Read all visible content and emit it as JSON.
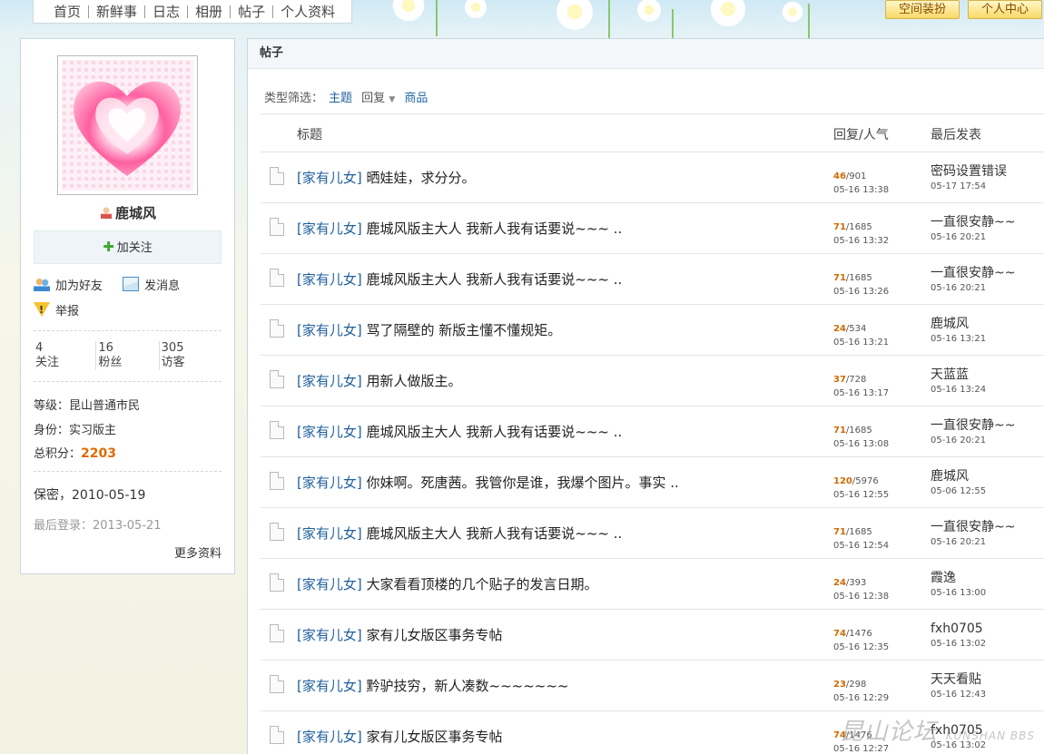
{
  "nav": {
    "items": [
      "首页",
      "新鲜事",
      "日志",
      "相册",
      "帖子",
      "个人资料"
    ],
    "decorate_button": "空间装扮",
    "user_center_button": "个人中心"
  },
  "profile": {
    "username": "鹿城风",
    "follow_label": "加关注",
    "add_friend_label": "加为好友",
    "message_label": "发消息",
    "report_label": "举报",
    "stats": [
      {
        "value": "4",
        "label": "关注"
      },
      {
        "value": "16",
        "label": "粉丝"
      },
      {
        "value": "305",
        "label": "访客"
      }
    ],
    "level_label": "等级：",
    "level_value": "昆山普通市民",
    "identity_label": "身份：",
    "identity_value": "实习版主",
    "score_label": "总积分：",
    "score_value": "2203",
    "secret_label": "保密，",
    "secret_date": "2010-05-19",
    "last_login_label": "最后登录：",
    "last_login_date": "2013-05-21",
    "more_label": "更多资料"
  },
  "main": {
    "header_title": "帖子",
    "filter_label": "类型筛选：",
    "filter_topic": "主题",
    "filter_reply": "回复",
    "filter_goods": "商品",
    "col_title": "标题",
    "col_stats": "回复/人气",
    "col_last": "最后发表",
    "posts": [
      {
        "cat": "[家有儿女]",
        "title": "晒娃娃，求分分。",
        "replies": "46",
        "views": "901",
        "time": "05-16 13:38",
        "last_user": "密码设置错误",
        "last_time": "05-17 17:54"
      },
      {
        "cat": "[家有儿女]",
        "title": "鹿城风版主大人 我新人我有话要说~~~ ..",
        "replies": "71",
        "views": "1685",
        "time": "05-16 13:32",
        "last_user": "一直很安静~~",
        "last_time": "05-16 20:21"
      },
      {
        "cat": "[家有儿女]",
        "title": "鹿城风版主大人 我新人我有话要说~~~ ..",
        "replies": "71",
        "views": "1685",
        "time": "05-16 13:26",
        "last_user": "一直很安静~~",
        "last_time": "05-16 20:21"
      },
      {
        "cat": "[家有儿女]",
        "title": "骂了隔壁的 新版主懂不懂规矩。",
        "replies": "24",
        "views": "534",
        "time": "05-16 13:21",
        "last_user": "鹿城风",
        "last_time": "05-16 13:21"
      },
      {
        "cat": "[家有儿女]",
        "title": "用新人做版主。",
        "replies": "37",
        "views": "728",
        "time": "05-16 13:17",
        "last_user": "天蓝蓝",
        "last_time": "05-16 13:24"
      },
      {
        "cat": "[家有儿女]",
        "title": "鹿城风版主大人 我新人我有话要说~~~ ..",
        "replies": "71",
        "views": "1685",
        "time": "05-16 13:08",
        "last_user": "一直很安静~~",
        "last_time": "05-16 20:21"
      },
      {
        "cat": "[家有儿女]",
        "title": "你妹啊。死唐茜。我管你是谁，我爆个图片。事实 ..",
        "replies": "120",
        "views": "5976",
        "time": "05-16 12:55",
        "last_user": "鹿城风",
        "last_time": "05-06 12:55"
      },
      {
        "cat": "[家有儿女]",
        "title": "鹿城风版主大人 我新人我有话要说~~~ ..",
        "replies": "71",
        "views": "1685",
        "time": "05-16 12:54",
        "last_user": "一直很安静~~",
        "last_time": "05-16 20:21"
      },
      {
        "cat": "[家有儿女]",
        "title": "大家看看顶楼的几个贴子的发言日期。",
        "replies": "24",
        "views": "393",
        "time": "05-16 12:38",
        "last_user": "霞逸",
        "last_time": "05-16 13:00"
      },
      {
        "cat": "[家有儿女]",
        "title": "家有儿女版区事务专帖",
        "replies": "74",
        "views": "1476",
        "time": "05-16 12:35",
        "last_user": "fxh0705",
        "last_time": "05-16 13:02"
      },
      {
        "cat": "[家有儿女]",
        "title": "黔驴技穷，新人凑数~~~~~~~",
        "replies": "23",
        "views": "298",
        "time": "05-16 12:29",
        "last_user": "天天看贴",
        "last_time": "05-16 12:43"
      },
      {
        "cat": "[家有儿女]",
        "title": "家有儿女版区事务专帖",
        "replies": "74",
        "views": "1476",
        "time": "05-16 12:27",
        "last_user": "fxh0705",
        "last_time": "05-16 13:02"
      }
    ]
  },
  "watermark": {
    "big": "昆山论坛",
    "small": "KUNSHAN BBS"
  }
}
